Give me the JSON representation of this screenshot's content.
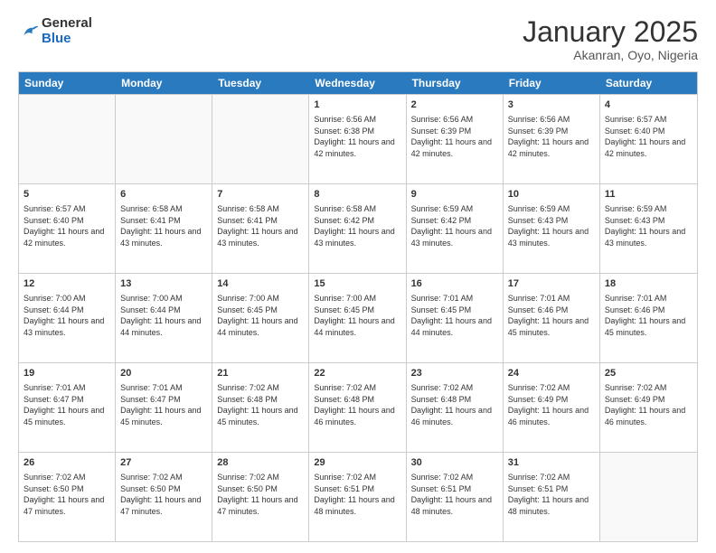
{
  "header": {
    "logo_general": "General",
    "logo_blue": "Blue",
    "month_title": "January 2025",
    "location": "Akanran, Oyo, Nigeria"
  },
  "weekdays": [
    "Sunday",
    "Monday",
    "Tuesday",
    "Wednesday",
    "Thursday",
    "Friday",
    "Saturday"
  ],
  "rows": [
    [
      {
        "day": "",
        "sunrise": "",
        "sunset": "",
        "daylight": ""
      },
      {
        "day": "",
        "sunrise": "",
        "sunset": "",
        "daylight": ""
      },
      {
        "day": "",
        "sunrise": "",
        "sunset": "",
        "daylight": ""
      },
      {
        "day": "1",
        "sunrise": "Sunrise: 6:56 AM",
        "sunset": "Sunset: 6:38 PM",
        "daylight": "Daylight: 11 hours and 42 minutes."
      },
      {
        "day": "2",
        "sunrise": "Sunrise: 6:56 AM",
        "sunset": "Sunset: 6:39 PM",
        "daylight": "Daylight: 11 hours and 42 minutes."
      },
      {
        "day": "3",
        "sunrise": "Sunrise: 6:56 AM",
        "sunset": "Sunset: 6:39 PM",
        "daylight": "Daylight: 11 hours and 42 minutes."
      },
      {
        "day": "4",
        "sunrise": "Sunrise: 6:57 AM",
        "sunset": "Sunset: 6:40 PM",
        "daylight": "Daylight: 11 hours and 42 minutes."
      }
    ],
    [
      {
        "day": "5",
        "sunrise": "Sunrise: 6:57 AM",
        "sunset": "Sunset: 6:40 PM",
        "daylight": "Daylight: 11 hours and 42 minutes."
      },
      {
        "day": "6",
        "sunrise": "Sunrise: 6:58 AM",
        "sunset": "Sunset: 6:41 PM",
        "daylight": "Daylight: 11 hours and 43 minutes."
      },
      {
        "day": "7",
        "sunrise": "Sunrise: 6:58 AM",
        "sunset": "Sunset: 6:41 PM",
        "daylight": "Daylight: 11 hours and 43 minutes."
      },
      {
        "day": "8",
        "sunrise": "Sunrise: 6:58 AM",
        "sunset": "Sunset: 6:42 PM",
        "daylight": "Daylight: 11 hours and 43 minutes."
      },
      {
        "day": "9",
        "sunrise": "Sunrise: 6:59 AM",
        "sunset": "Sunset: 6:42 PM",
        "daylight": "Daylight: 11 hours and 43 minutes."
      },
      {
        "day": "10",
        "sunrise": "Sunrise: 6:59 AM",
        "sunset": "Sunset: 6:43 PM",
        "daylight": "Daylight: 11 hours and 43 minutes."
      },
      {
        "day": "11",
        "sunrise": "Sunrise: 6:59 AM",
        "sunset": "Sunset: 6:43 PM",
        "daylight": "Daylight: 11 hours and 43 minutes."
      }
    ],
    [
      {
        "day": "12",
        "sunrise": "Sunrise: 7:00 AM",
        "sunset": "Sunset: 6:44 PM",
        "daylight": "Daylight: 11 hours and 43 minutes."
      },
      {
        "day": "13",
        "sunrise": "Sunrise: 7:00 AM",
        "sunset": "Sunset: 6:44 PM",
        "daylight": "Daylight: 11 hours and 44 minutes."
      },
      {
        "day": "14",
        "sunrise": "Sunrise: 7:00 AM",
        "sunset": "Sunset: 6:45 PM",
        "daylight": "Daylight: 11 hours and 44 minutes."
      },
      {
        "day": "15",
        "sunrise": "Sunrise: 7:00 AM",
        "sunset": "Sunset: 6:45 PM",
        "daylight": "Daylight: 11 hours and 44 minutes."
      },
      {
        "day": "16",
        "sunrise": "Sunrise: 7:01 AM",
        "sunset": "Sunset: 6:45 PM",
        "daylight": "Daylight: 11 hours and 44 minutes."
      },
      {
        "day": "17",
        "sunrise": "Sunrise: 7:01 AM",
        "sunset": "Sunset: 6:46 PM",
        "daylight": "Daylight: 11 hours and 45 minutes."
      },
      {
        "day": "18",
        "sunrise": "Sunrise: 7:01 AM",
        "sunset": "Sunset: 6:46 PM",
        "daylight": "Daylight: 11 hours and 45 minutes."
      }
    ],
    [
      {
        "day": "19",
        "sunrise": "Sunrise: 7:01 AM",
        "sunset": "Sunset: 6:47 PM",
        "daylight": "Daylight: 11 hours and 45 minutes."
      },
      {
        "day": "20",
        "sunrise": "Sunrise: 7:01 AM",
        "sunset": "Sunset: 6:47 PM",
        "daylight": "Daylight: 11 hours and 45 minutes."
      },
      {
        "day": "21",
        "sunrise": "Sunrise: 7:02 AM",
        "sunset": "Sunset: 6:48 PM",
        "daylight": "Daylight: 11 hours and 45 minutes."
      },
      {
        "day": "22",
        "sunrise": "Sunrise: 7:02 AM",
        "sunset": "Sunset: 6:48 PM",
        "daylight": "Daylight: 11 hours and 46 minutes."
      },
      {
        "day": "23",
        "sunrise": "Sunrise: 7:02 AM",
        "sunset": "Sunset: 6:48 PM",
        "daylight": "Daylight: 11 hours and 46 minutes."
      },
      {
        "day": "24",
        "sunrise": "Sunrise: 7:02 AM",
        "sunset": "Sunset: 6:49 PM",
        "daylight": "Daylight: 11 hours and 46 minutes."
      },
      {
        "day": "25",
        "sunrise": "Sunrise: 7:02 AM",
        "sunset": "Sunset: 6:49 PM",
        "daylight": "Daylight: 11 hours and 46 minutes."
      }
    ],
    [
      {
        "day": "26",
        "sunrise": "Sunrise: 7:02 AM",
        "sunset": "Sunset: 6:50 PM",
        "daylight": "Daylight: 11 hours and 47 minutes."
      },
      {
        "day": "27",
        "sunrise": "Sunrise: 7:02 AM",
        "sunset": "Sunset: 6:50 PM",
        "daylight": "Daylight: 11 hours and 47 minutes."
      },
      {
        "day": "28",
        "sunrise": "Sunrise: 7:02 AM",
        "sunset": "Sunset: 6:50 PM",
        "daylight": "Daylight: 11 hours and 47 minutes."
      },
      {
        "day": "29",
        "sunrise": "Sunrise: 7:02 AM",
        "sunset": "Sunset: 6:51 PM",
        "daylight": "Daylight: 11 hours and 48 minutes."
      },
      {
        "day": "30",
        "sunrise": "Sunrise: 7:02 AM",
        "sunset": "Sunset: 6:51 PM",
        "daylight": "Daylight: 11 hours and 48 minutes."
      },
      {
        "day": "31",
        "sunrise": "Sunrise: 7:02 AM",
        "sunset": "Sunset: 6:51 PM",
        "daylight": "Daylight: 11 hours and 48 minutes."
      },
      {
        "day": "",
        "sunrise": "",
        "sunset": "",
        "daylight": ""
      }
    ]
  ]
}
